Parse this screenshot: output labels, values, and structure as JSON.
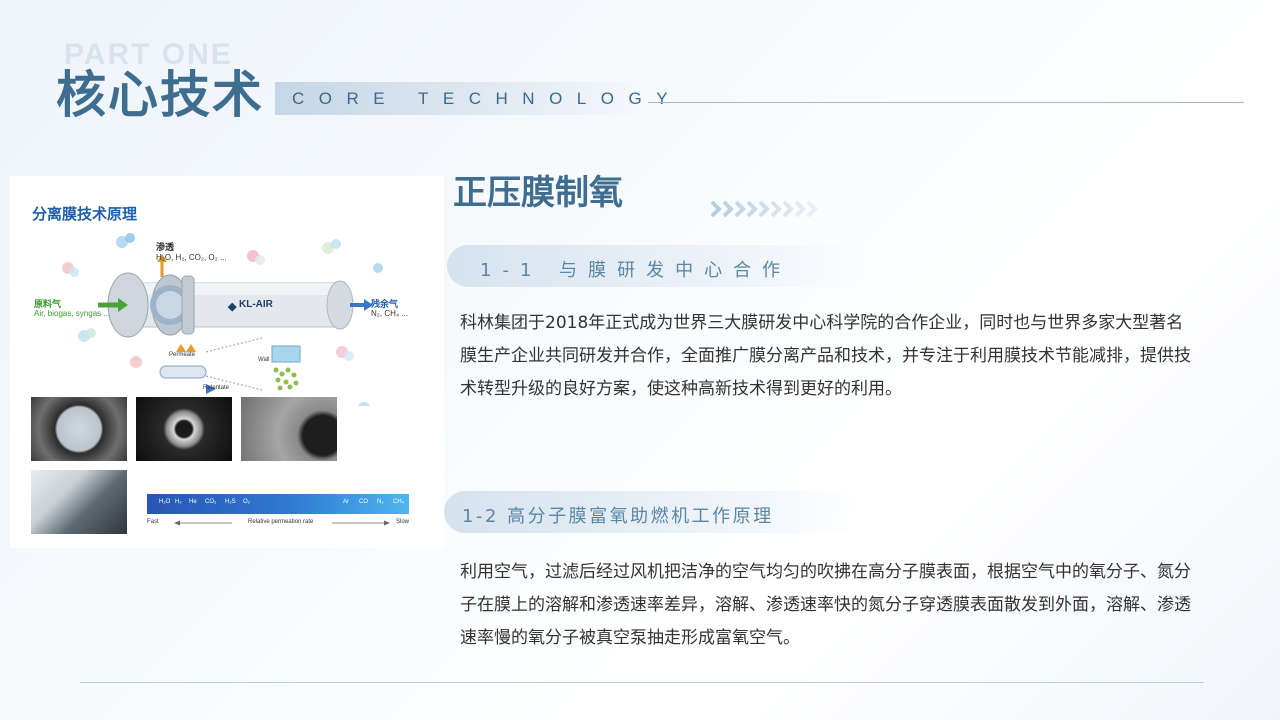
{
  "header": {
    "part_label": "PART ONE",
    "title": "核心技术",
    "subtitle": "CORE TECHNOLOGY"
  },
  "image_panel": {
    "diagram_title": "分离膜技术原理",
    "permeate_label": "渗透",
    "permeate_gases": "H₂O, H₂, CO₂, O₂ ...",
    "feed_label": "原料气",
    "feed_desc": "Air, biogas, syngas ...",
    "residue_label": "残余气",
    "residue_desc": "N₂, CH₄ ...",
    "brand": "KL-AIR",
    "permeate_en": "Permeate",
    "retentate_en": "Retentate",
    "wall_en": "Wall",
    "scale_gases": [
      "H₂O",
      "H₂",
      "He",
      "CO₂",
      "H₂S",
      "O₂",
      "Ar",
      "CO",
      "N₂",
      "CH₄"
    ],
    "scale_fast": "Fast",
    "scale_mid": "Relative permeation rate",
    "scale_slow": "Slow"
  },
  "section": {
    "title": "正压膜制氧",
    "sub1": "1-1 与膜研发中心合作",
    "para1": "科林集团于2018年正式成为世界三大膜研发中心科学院的合作企业，同时也与世界多家大型著名膜生产企业共同研发并合作，全面推广膜分离产品和技术，并专注于利用膜技术节能减排，提供技术转型升级的良好方案，使这种高新技术得到更好的利用。",
    "sub2": "1-2 高分子膜富氧助燃机工作原理",
    "para2": "利用空气，过滤后经过风机把洁净的空气均匀的吹拂在高分子膜表面，根据空气中的氧分子、氮分子在膜上的溶解和渗透速率差异，溶解、渗透速率快的氮分子穿透膜表面散发到外面，溶解、渗透速率慢的氧分子被真空泵抽走形成富氧空气。"
  },
  "colors": {
    "title_blue": "#3f6d90",
    "accent_blue": "#5a86a6",
    "diagram_blue": "#1f5ea8"
  }
}
